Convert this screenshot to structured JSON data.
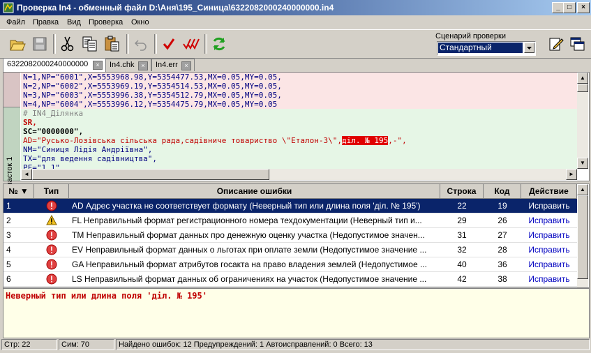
{
  "window": {
    "title": "Проверка In4 - обменный файл D:\\Аня\\195_Синица\\6322082000240000000.in4"
  },
  "menu": [
    "Файл",
    "Правка",
    "Вид",
    "Проверка",
    "Окно"
  ],
  "toolbar": {
    "scenario_label": "Сценарий проверки",
    "scenario_value": "Стандартный",
    "icons": [
      "open-folder-icon",
      "save-icon",
      "cut-icon",
      "copy-icon",
      "paste-icon",
      "undo-icon",
      "check-icon",
      "check-all-icon",
      "refresh-icon",
      "edit-icon",
      "windows-icon"
    ]
  },
  "tabs": [
    {
      "label": "6322082000240000000"
    },
    {
      "label": "In4.chk"
    },
    {
      "label": "In4.err"
    }
  ],
  "editor": {
    "section_label": "Участок 1",
    "lines": [
      "N=1,NP=\"6001\",X=5553968.98,Y=5354477.53,MX=0.05,MY=0.05,",
      "N=2,NP=\"6002\",X=5553969.19,Y=5354514.53,MX=0.05,MY=0.05,",
      "N=3,NP=\"6003\",X=5553996.38,Y=5354512.79,MX=0.05,MY=0.05,",
      "N=4,NP=\"6004\",X=5553996.12,Y=5354475.79,MX=0.05,MY=0.05",
      "# IN4_Ділянка",
      "SR,",
      "SC=\"0000000\",",
      "AD=\"Русько-Лозівська сільська рада,садівниче товариство \\\"Еталон-3\\\",",
      "NM=\"Синиця Лідія Андріївна\",",
      "TX=\"для ведення садівництва\",",
      "PF=\"1.1\","
    ],
    "ad_highlight": "діл. № 195",
    "ad_tail": ",-\","
  },
  "table": {
    "headers": {
      "num": "№",
      "type": "Тип",
      "desc": "Описание ошибки",
      "line": "Строка",
      "code": "Код",
      "action": "Действие"
    },
    "rows": [
      {
        "num": "1",
        "type": "error",
        "desc": "AD Адрес участка не соответствует формату (Неверный тип или длина поля 'діл. № 195')",
        "line": "22",
        "code": "19",
        "action": "Исправить"
      },
      {
        "num": "2",
        "type": "warning",
        "desc": "FL Неправильный формат регистрационного номера техдокументации (Неверный тип и...",
        "line": "29",
        "code": "26",
        "action": "Исправить"
      },
      {
        "num": "3",
        "type": "error",
        "desc": "TM Неправильный формат данных про денежную оценку участка (Недопустимое значен...",
        "line": "31",
        "code": "27",
        "action": "Исправить"
      },
      {
        "num": "4",
        "type": "error",
        "desc": "EV Неправильный формат данных о льготах при оплате земли (Недопустимое значение ...",
        "line": "32",
        "code": "28",
        "action": "Исправить"
      },
      {
        "num": "5",
        "type": "error",
        "desc": "GA Неправильный формат атрибутов госакта на право владения землей (Недопустимое ...",
        "line": "40",
        "code": "36",
        "action": "Исправить"
      },
      {
        "num": "6",
        "type": "error",
        "desc": "LS Неправильный формат данных об ограничениях на участок (Недопустимое значение ...",
        "line": "42",
        "code": "38",
        "action": "Исправить"
      }
    ]
  },
  "message": "Неверный тип или длина поля 'діл. № 195'",
  "status": {
    "row": "Стр: 22",
    "col": "Сим: 70",
    "summary": "Найдено ошибок: 12  Предупреждений: 1  Автоисправлений: 0  Всего: 13"
  }
}
